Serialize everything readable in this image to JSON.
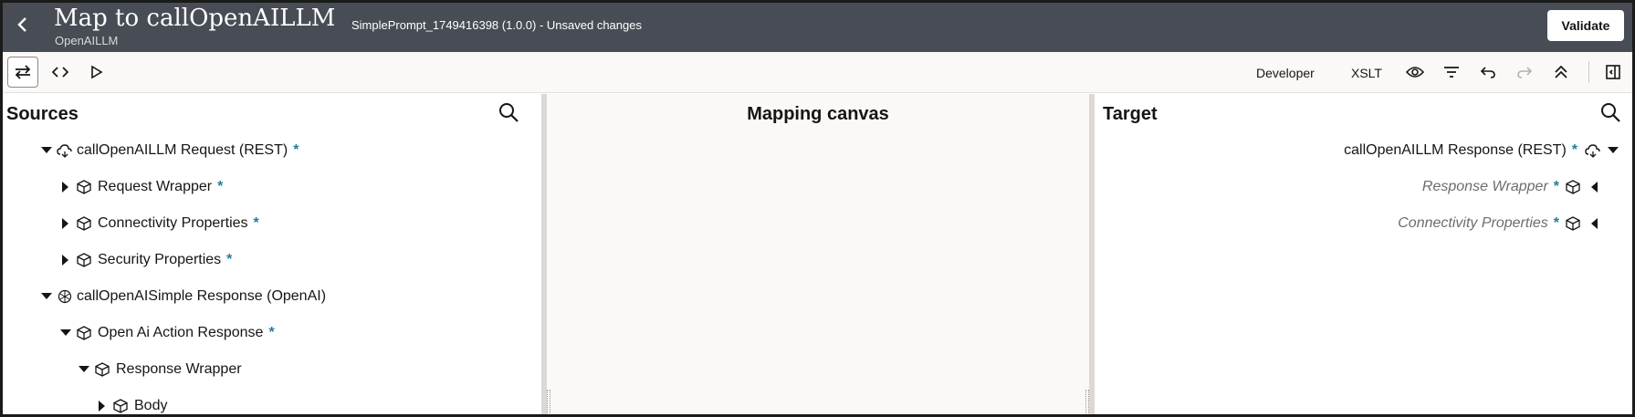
{
  "header": {
    "title": "Map to callOpenAILLM",
    "subtitle": "OpenAILLM",
    "status": "SimplePrompt_1749416398 (1.0.0) - Unsaved changes",
    "validate_label": "Validate",
    "background": "#474c55"
  },
  "toolbar": {
    "developer_label": "Developer",
    "xslt_label": "XSLT",
    "icons": [
      "swap-icon",
      "code-icon",
      "play-icon",
      "eye-icon",
      "filter-icon",
      "undo-icon",
      "redo-icon",
      "collapse-all-icon",
      "panel-toggle-icon"
    ]
  },
  "sources": {
    "title": "Sources",
    "tree": [
      {
        "label": "callOpenAILLM Request (REST)",
        "required": "*",
        "expanded": true,
        "icon": "rest-cloud-icon"
      },
      {
        "label": "Request Wrapper",
        "required": "*",
        "expanded": false,
        "icon": "cube-icon"
      },
      {
        "label": "Connectivity Properties",
        "required": "*",
        "expanded": false,
        "icon": "cube-icon"
      },
      {
        "label": "Security Properties",
        "required": "*",
        "expanded": false,
        "icon": "cube-icon"
      },
      {
        "label": "callOpenAISimple Response (OpenAI)",
        "required": "",
        "expanded": true,
        "icon": "openai-icon"
      },
      {
        "label": "Open Ai Action Response",
        "required": "*",
        "expanded": true,
        "icon": "cube-icon"
      },
      {
        "label": "Response Wrapper",
        "required": "",
        "expanded": true,
        "icon": "cube-icon"
      },
      {
        "label": "Body",
        "required": "",
        "expanded": false,
        "icon": "cube-icon"
      }
    ]
  },
  "canvas": {
    "title": "Mapping canvas"
  },
  "target": {
    "title": "Target",
    "tree": [
      {
        "label": "callOpenAILLM Response (REST)",
        "required": "*",
        "expanded": true,
        "icon": "rest-cloud-icon"
      },
      {
        "label": "Response Wrapper",
        "required": "*",
        "expanded": false,
        "icon": "cube-icon"
      },
      {
        "label": "Connectivity Properties",
        "required": "*",
        "expanded": false,
        "icon": "cube-icon"
      }
    ]
  },
  "colors": {
    "accent_star": "#227e9e",
    "canvas_bg": "#fbf9f8"
  }
}
